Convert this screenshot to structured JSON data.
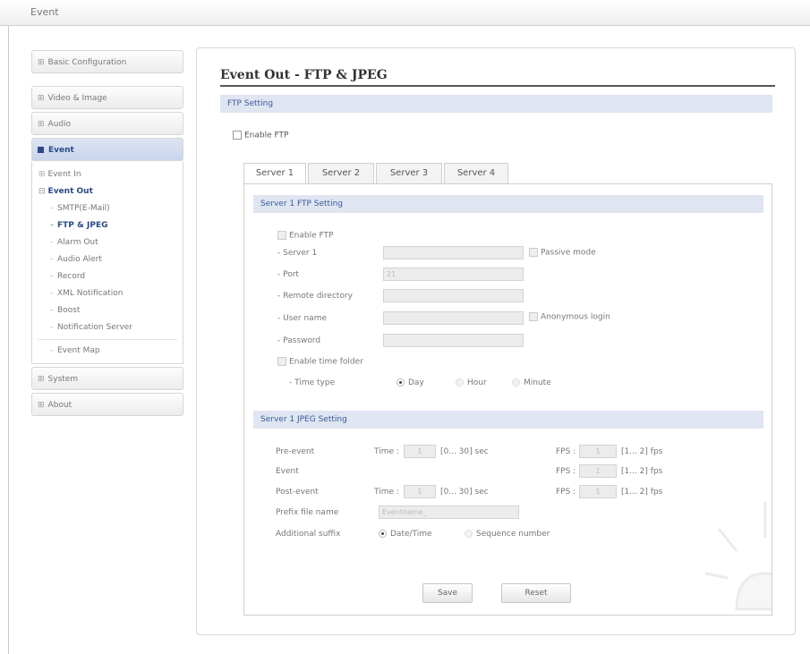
{
  "window": {
    "title": "Event"
  },
  "sidebar": {
    "basic": "Basic Configuration",
    "video": "Video & Image",
    "audio": "Audio",
    "event": "Event",
    "event_items": {
      "event_in": "Event In",
      "event_out": "Event Out",
      "smtp": "SMTP(E-Mail)",
      "ftp": "FTP & JPEG",
      "alarm": "Alarm Out",
      "audio_alert": "Audio Alert",
      "record": "Record",
      "xml": "XML Notification",
      "boost": "Boost",
      "notif_server": "Notification Server",
      "event_map": "Event Map"
    },
    "system": "System",
    "about": "About"
  },
  "main": {
    "title": "Event Out - FTP & JPEG",
    "ftp_setting_header": "FTP Setting",
    "enable_ftp_label": "Enable FTP",
    "tabs": [
      "Server 1",
      "Server 2",
      "Server 3",
      "Server 4"
    ],
    "server_ftp_header": "Server 1 FTP Setting",
    "server_enable_ftp": "Enable FTP",
    "server_label": "- Server 1",
    "passive_mode": "Passive mode",
    "port_label": "- Port",
    "port_value": "21",
    "remote_dir_label": "- Remote directory",
    "user_name_label": "- User name",
    "anonymous_login": "Anonymous login",
    "password_label": "- Password",
    "enable_time_folder": "Enable time folder",
    "time_type_label": "- Time type",
    "time_type_options": [
      "Day",
      "Hour",
      "Minute"
    ],
    "jpeg_header": "Server 1 JPEG Setting",
    "pre_event": "Pre-event",
    "event": "Event",
    "post_event": "Post-event",
    "time_label": "Time :",
    "fps_label": "FPS :",
    "time_value": "1",
    "fps_value": "1",
    "time_range": "[0... 30] sec",
    "fps_range": "[1... 2] fps",
    "prefix_label": "Prefix file name",
    "prefix_value": "Eventname_",
    "suffix_label": "Additional suffix",
    "suffix_options": [
      "Date/Time",
      "Sequence number"
    ],
    "save": "Save",
    "reset": "Reset"
  }
}
